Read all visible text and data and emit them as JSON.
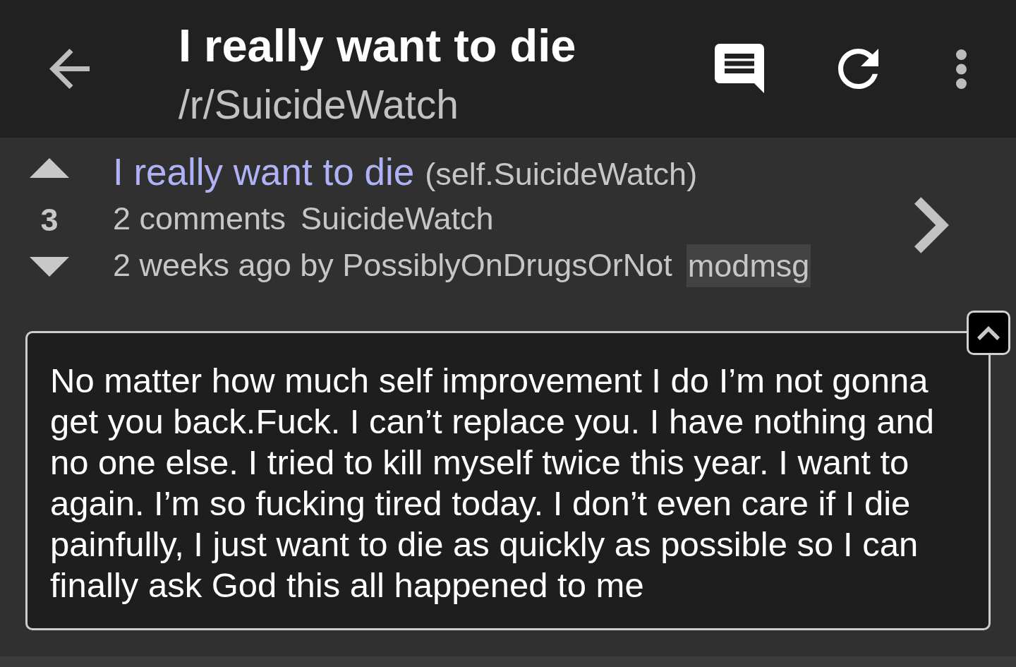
{
  "toolbar": {
    "title": "I really want to die",
    "subtitle": "/r/SuicideWatch"
  },
  "post": {
    "score": "3",
    "title": "I really want to die",
    "domain": "(self.SuicideWatch)",
    "comments": "2 comments",
    "subreddit": "SuicideWatch",
    "byline": "2 weeks ago by PossiblyOnDrugsOrNot",
    "flair": "modmsg",
    "body": "No matter how much self improvement I do I’m not gonna get you back.Fuck. I can’t replace you. I have nothing and no one else. I tried to kill myself twice this year. I want to again. I’m so fucking tired today. I don’t even care if I die painfully, I just want to die as quickly as possible so I can finally ask God this all happened to me"
  }
}
